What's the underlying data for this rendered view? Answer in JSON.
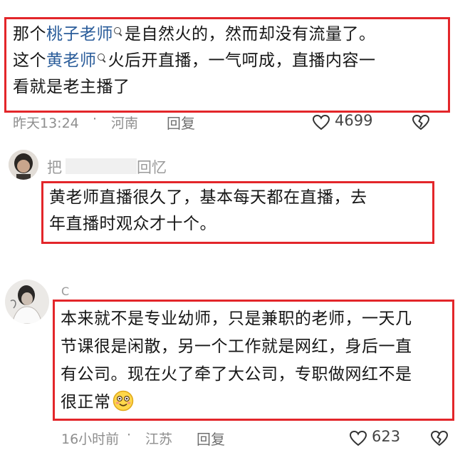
{
  "comment1": {
    "line1_a": "那个",
    "line1_link": "桃子老师",
    "line1_b": "是自然火的，然而却没有流量了。",
    "line2_a": "这个",
    "line2_link": "黄老师",
    "line2_b": "火后开直播，一气呵成，直播内容一",
    "line3": "看就是老主播了",
    "time": "昨天13:24",
    "location": "河南",
    "reply": "回复",
    "likes": "4699"
  },
  "comment2": {
    "username_first": "把",
    "username_last": "回忆",
    "line1": "黄老师直播很久了，基本每天都在直播，去",
    "line2": "年直播时观众才十个。"
  },
  "comment3": {
    "username": "C",
    "line1": "本来就不是专业幼师，只是兼职的老师，一天几",
    "line2": "节课很是闲散，另一个工作就是网红，身后一直",
    "line3": "有公司。现在火了牵了大公司，专职做网红不是",
    "line4": "很正常",
    "time": "16小时前",
    "location": "江苏",
    "reply": "回复",
    "likes": "623"
  },
  "colors": {
    "highlight_border": "#e3262a",
    "link": "#2a5c9a",
    "meta": "#8e8e8e"
  },
  "icons": [
    "search-icon",
    "heart-icon",
    "broken-heart-icon",
    "smiling-face-emoji"
  ]
}
